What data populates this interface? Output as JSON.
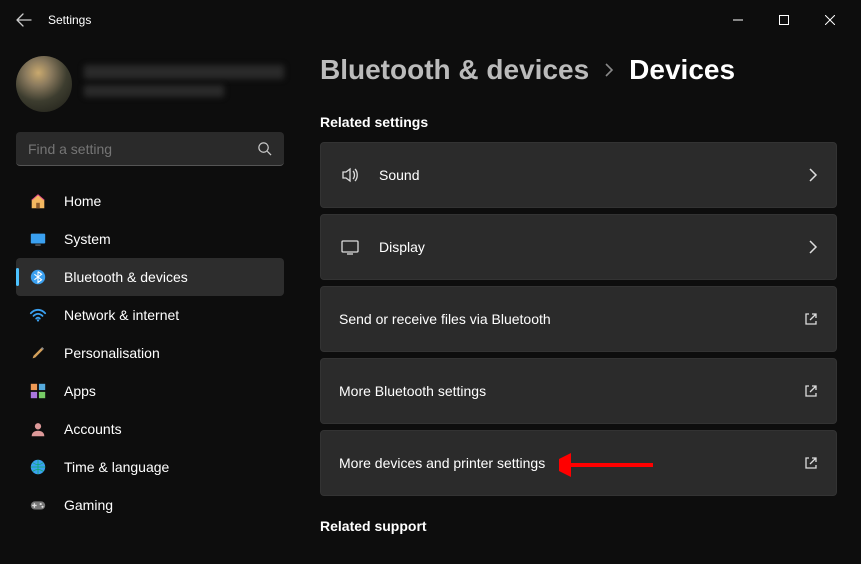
{
  "window": {
    "title": "Settings"
  },
  "search": {
    "placeholder": "Find a setting"
  },
  "nav": {
    "home": "Home",
    "system": "System",
    "bluetooth": "Bluetooth & devices",
    "network": "Network & internet",
    "personal": "Personalisation",
    "apps": "Apps",
    "accounts": "Accounts",
    "time": "Time & language",
    "gaming": "Gaming"
  },
  "breadcrumb": {
    "parent": "Bluetooth & devices",
    "current": "Devices"
  },
  "sections": {
    "related": "Related settings",
    "support": "Related support"
  },
  "cards": {
    "sound": "Sound",
    "display": "Display",
    "btfiles": "Send or receive files via Bluetooth",
    "morebt": "More Bluetooth settings",
    "printers": "More devices and printer settings"
  }
}
